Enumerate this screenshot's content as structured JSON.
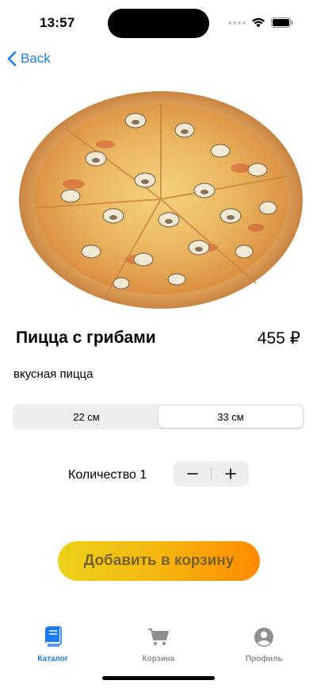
{
  "status_bar": {
    "time": "13:57"
  },
  "nav": {
    "back_label": "Back"
  },
  "product": {
    "title": "Пицца с грибами",
    "price": "455 ₽",
    "description": "вкусная пицца",
    "image_icon": "pizza-image"
  },
  "size_selector": {
    "options": [
      "22 см",
      "33 см"
    ],
    "selected": "33 см"
  },
  "quantity": {
    "label": "Количество 1",
    "value": 1
  },
  "add_to_cart": {
    "label": "Добавить в корзину"
  },
  "tab_bar": {
    "tabs": [
      {
        "label": "Каталог",
        "icon": "book-icon",
        "active": true
      },
      {
        "label": "Корзина",
        "icon": "cart-icon",
        "active": false
      },
      {
        "label": "Профиль",
        "icon": "profile-icon",
        "active": false
      }
    ]
  },
  "colors": {
    "accent": "#1a7cf5",
    "inactive": "#8e8e93",
    "button_gradient_start": "#ecd21a",
    "button_gradient_end": "#ff8a00",
    "button_text": "#79622d"
  }
}
